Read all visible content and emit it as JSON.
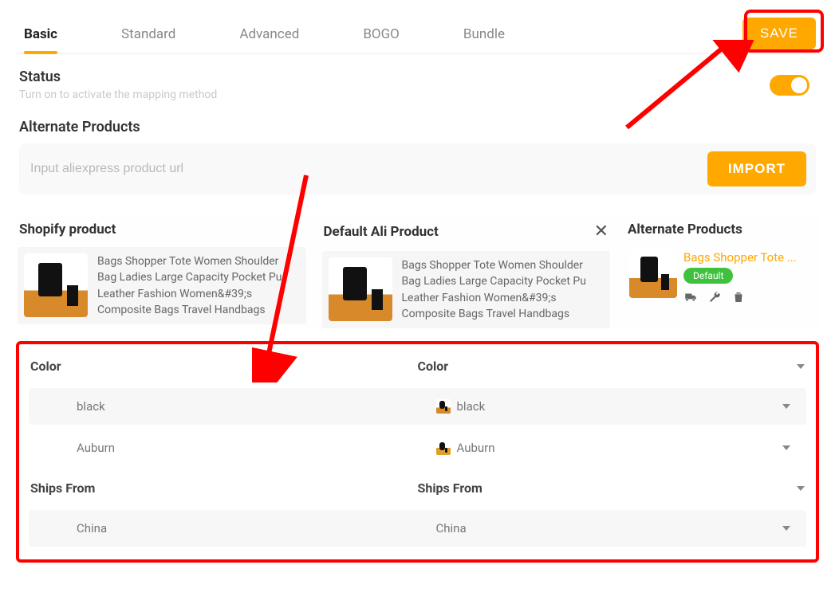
{
  "tabs": [
    "Basic",
    "Standard",
    "Advanced",
    "BOGO",
    "Bundle"
  ],
  "save_label": "SAVE",
  "status": {
    "title": "Status",
    "subtitle": "Turn on to activate the mapping method",
    "on": true
  },
  "alternate": {
    "title": "Alternate Products",
    "placeholder": "Input aliexpress product url",
    "import_label": "IMPORT"
  },
  "columns": {
    "shopify": "Shopify product",
    "ali": "Default Ali Product",
    "alt": "Alternate Products"
  },
  "product_desc": "Bags Shopper Tote Women Shoulder Bag Ladies Large Capacity Pocket Pu Leather Fashion Women&#39;s Composite Bags Travel Handbags",
  "alt_product": {
    "title": "Bags Shopper Tote ...",
    "badge": "Default"
  },
  "variants": [
    {
      "type": "header",
      "left": "Color",
      "right": "Color"
    },
    {
      "type": "row",
      "left": "black",
      "right": "black",
      "swatch": true
    },
    {
      "type": "row",
      "left": "Auburn",
      "right": "Auburn",
      "swatch": true,
      "plain": true
    },
    {
      "type": "header",
      "left": "Ships From",
      "right": "Ships From"
    },
    {
      "type": "row",
      "left": "China",
      "right": "China",
      "swatch": false
    }
  ]
}
